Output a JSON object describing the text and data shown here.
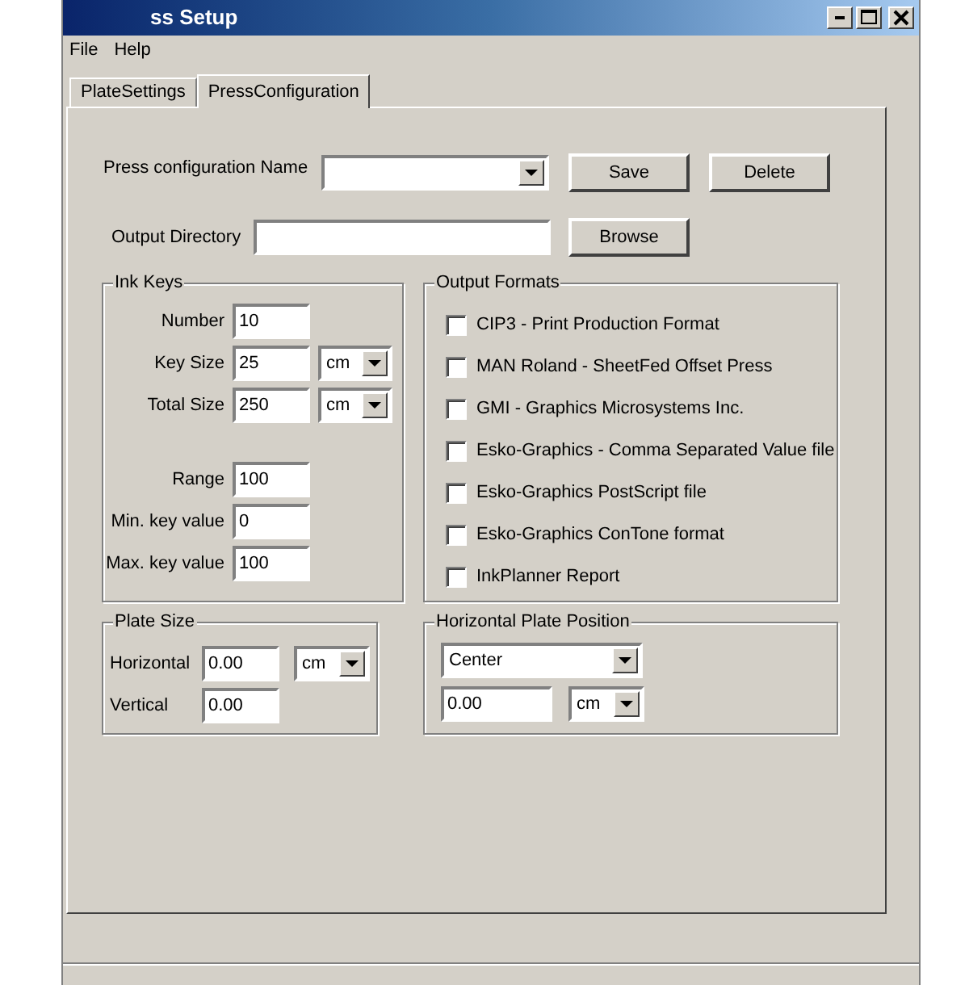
{
  "window": {
    "title": "ss Setup"
  },
  "menu": [
    "File",
    "Help"
  ],
  "tabs": [
    {
      "label": "PlateSettings",
      "selected": false
    },
    {
      "label": "PressConfiguration",
      "selected": true
    }
  ],
  "press_configuration": {
    "label": "Press configuration Name",
    "buttons": [
      "Save",
      "Delete"
    ]
  },
  "output_directory": {
    "label": "Output Directory",
    "button": "Browse"
  },
  "ink_keys": {
    "title": "Ink Keys",
    "fields": [
      {
        "label": "Number",
        "value": "10"
      },
      {
        "label": "Key Size",
        "value": "25",
        "unit": "cm"
      },
      {
        "label": "Total Size",
        "value": "250",
        "unit": "cm"
      },
      {
        "label": "Range",
        "value": "100"
      },
      {
        "label": "Min. key value",
        "value": "0"
      },
      {
        "label": "Max. key value",
        "value": "100"
      }
    ]
  },
  "output_formats": {
    "title": "Output Formats",
    "options": [
      {
        "label": "CIP3 - Print Production Format",
        "checked": false
      },
      {
        "label": "MAN Roland - SheetFed Offset Press",
        "checked": false
      },
      {
        "label": "GMI - Graphics Microsystems Inc.",
        "checked": false
      },
      {
        "label": "Esko-Graphics - Comma Separated Value file",
        "checked": false
      },
      {
        "label": "Esko-Graphics PostScript file",
        "checked": false
      },
      {
        "label": "Esko-Graphics ConTone format",
        "checked": false
      },
      {
        "label": "InkPlanner Report",
        "checked": false
      }
    ]
  },
  "plate_size": {
    "title": "Plate Size",
    "fields": [
      {
        "label": "Horizontal",
        "value": "0.00",
        "unit": "cm"
      },
      {
        "label": "Vertical",
        "value": "0.00"
      }
    ]
  },
  "horizontal_plate_position": {
    "title": "Horizontal Plate Position",
    "alignment": "Center",
    "value": "0.00",
    "unit": "cm"
  }
}
